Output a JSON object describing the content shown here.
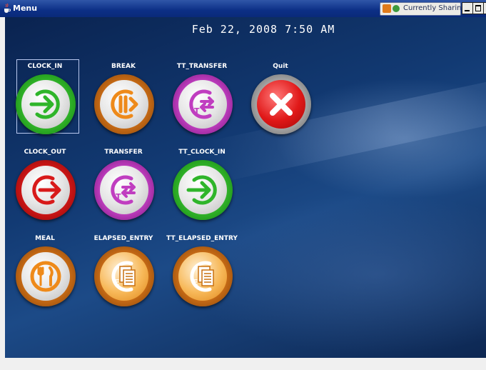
{
  "window": {
    "title": "Menu",
    "sharing_label": "Currently Sharing"
  },
  "datetime": "Feb 22, 2008 7:50 AM",
  "buttons": [
    {
      "label": "CLOCK_IN",
      "icon": "clock-in-arrow-icon",
      "color": "#2fb52a",
      "selected": true
    },
    {
      "label": "BREAK",
      "icon": "break-pause-icon",
      "color": "#c96c16"
    },
    {
      "label": "TT_TRANSFER",
      "icon": "tt-transfer-arrows-icon",
      "color": "#c03ec0"
    },
    {
      "label": "Quit",
      "icon": "quit-x-icon",
      "color": "#d01616"
    },
    {
      "label": "CLOCK_OUT",
      "icon": "clock-out-arrow-icon",
      "color": "#d01616"
    },
    {
      "label": "TRANSFER",
      "icon": "transfer-arrows-icon",
      "color": "#c03ec0"
    },
    {
      "label": "TT_CLOCK_IN",
      "icon": "tt-clock-in-arrow-icon",
      "color": "#2fb52a"
    },
    {
      "label": "MEAL",
      "icon": "meal-fork-knife-icon",
      "color": "#c96c16"
    },
    {
      "label": "ELAPSED_ENTRY",
      "icon": "elapsed-entry-icon",
      "color": "#c96c16"
    },
    {
      "label": "TT_ELAPSED_ENTRY",
      "icon": "tt-elapsed-entry-icon",
      "color": "#c96c16"
    }
  ]
}
